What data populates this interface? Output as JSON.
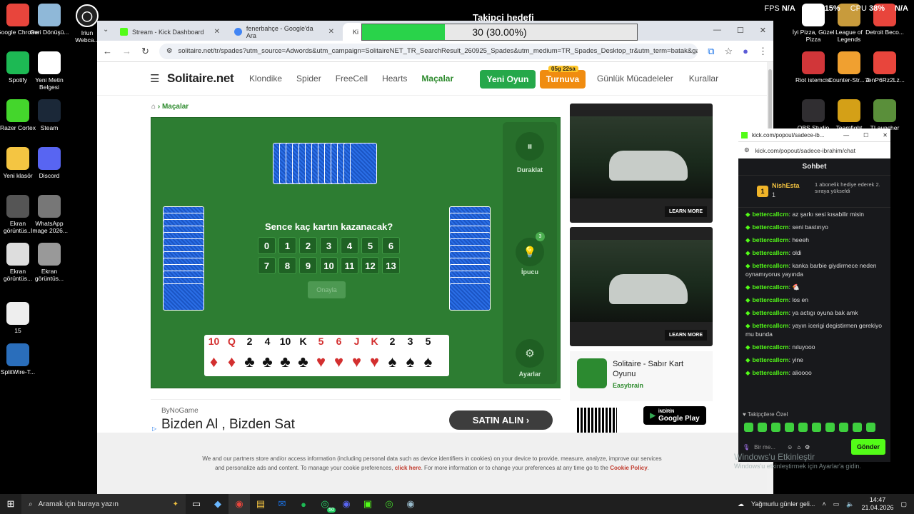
{
  "overlay": {
    "goal_title": "Takipci hedefi",
    "goal_text": "30 (30.00%)",
    "goal_progress": 0.3,
    "fps_label": "FPS",
    "fps_value": "N/A",
    "gpu_label": "GPU",
    "gpu_value": "15%",
    "cpu_label": "CPU",
    "cpu_value": "38%",
    "na_label": "N/A"
  },
  "desktop_left": [
    {
      "label": "Google Chrome",
      "icon": "chrome-icon",
      "color": "#e8453c"
    },
    {
      "label": "Geri Dönüşü...",
      "icon": "recycle-bin-icon",
      "color": "#8fb8d8"
    },
    {
      "label": "Spotify",
      "icon": "spotify-icon",
      "color": "#1db954"
    },
    {
      "label": "Yeni Metin Belgesi",
      "icon": "text-file-icon",
      "color": "#ffffff"
    },
    {
      "label": "Razer Cortex",
      "icon": "razer-icon",
      "color": "#44d62c"
    },
    {
      "label": "Steam",
      "icon": "steam-icon",
      "color": "#1b2838"
    },
    {
      "label": "Yeni klasör",
      "icon": "folder-icon",
      "color": "#f4c542"
    },
    {
      "label": "Discord",
      "icon": "discord-icon",
      "color": "#5865f2"
    },
    {
      "label": "Ekran görüntüs...",
      "icon": "image-icon",
      "color": "#555555"
    },
    {
      "label": "WhatsApp Image 2026...",
      "icon": "image-icon",
      "color": "#777777"
    },
    {
      "label": "Ekran görüntüs...",
      "icon": "image-icon",
      "color": "#dddddd"
    },
    {
      "label": "Ekran görüntüs...",
      "icon": "image-icon",
      "color": "#999999"
    },
    {
      "label": "15",
      "icon": "image-icon",
      "color": "#eeeeee"
    },
    {
      "label": "SplitWire-T...",
      "icon": "splitwire-icon",
      "color": "#2a6ebb"
    }
  ],
  "desktop_partial": {
    "label": "Iriun Webca...",
    "icon": "webcam-icon"
  },
  "desktop_right": [
    {
      "label": "İyi Pizza, Güzel Pizza",
      "icon": "file-icon",
      "color": "#ffffff"
    },
    {
      "label": "League of Legends",
      "icon": "lol-icon",
      "color": "#c89b3c"
    },
    {
      "label": "Detroit Beco...",
      "icon": "chrome-icon",
      "color": "#e8453c"
    },
    {
      "label": "Riot istemcisi",
      "icon": "riot-icon",
      "color": "#d13639"
    },
    {
      "label": "Counter-Str... 2",
      "icon": "cs2-icon",
      "color": "#f0a030"
    },
    {
      "label": "7enP6Rz2Lz...",
      "icon": "chrome-icon",
      "color": "#e8453c"
    },
    {
      "label": "OBS Studio",
      "icon": "obs-icon",
      "color": "#302e31"
    },
    {
      "label": "Teamfight",
      "icon": "tft-icon",
      "color": "#d4a017"
    },
    {
      "label": "TLauncher",
      "icon": "minecraft-icon",
      "color": "#5a8f3a"
    }
  ],
  "browser": {
    "tabs": [
      {
        "title": "Stream - Kick Dashboard",
        "fav": "#53fc18"
      },
      {
        "title": "fenerbahçe - Google'da Ara",
        "fav": "#4285f4"
      },
      {
        "title": "Ki",
        "fav": "#f0a010"
      }
    ],
    "url": "solitaire.net/tr/spades?utm_source=Adwords&utm_campaign=SolitaireNET_TR_SearchResult_260925_Spades&utm_medium=TR_Spades_Desktop_tr&utm_term=batak&gad_sou..."
  },
  "site": {
    "logo": "Solitaire.net",
    "nav": [
      "Klondike",
      "Spider",
      "FreeCell",
      "Hearts",
      "Maçalar"
    ],
    "active_nav": "Maçalar",
    "new_game": "Yeni Oyun",
    "tournament": "Turnuva",
    "tournament_badge": "05g 22sa",
    "nav_right": [
      "Günlük Mücadeleler",
      "Kurallar"
    ],
    "breadcrumb": "Maçalar"
  },
  "game": {
    "bid_question": "Sence kaç kartın kazanacak?",
    "bid_numbers": [
      "0",
      "1",
      "2",
      "3",
      "4",
      "5",
      "6",
      "7",
      "8",
      "9",
      "10",
      "11",
      "12",
      "13"
    ],
    "confirm": "Onayla",
    "pause_label": "Duraklat",
    "hint_label": "İpucu",
    "hint_count": "3",
    "settings_label": "Ayarlar",
    "hand": [
      {
        "rank": "10",
        "suit": "♦",
        "color": "#d32f2f"
      },
      {
        "rank": "Q",
        "suit": "♦",
        "color": "#d32f2f"
      },
      {
        "rank": "2",
        "suit": "♣",
        "color": "#111111"
      },
      {
        "rank": "4",
        "suit": "♣",
        "color": "#111111"
      },
      {
        "rank": "10",
        "suit": "♣",
        "color": "#111111"
      },
      {
        "rank": "K",
        "suit": "♣",
        "color": "#111111"
      },
      {
        "rank": "5",
        "suit": "♥",
        "color": "#d32f2f"
      },
      {
        "rank": "6",
        "suit": "♥",
        "color": "#d32f2f"
      },
      {
        "rank": "J",
        "suit": "♥",
        "color": "#d32f2f"
      },
      {
        "rank": "K",
        "suit": "♥",
        "color": "#d32f2f"
      },
      {
        "rank": "2",
        "suit": "♠",
        "color": "#111111"
      },
      {
        "rank": "3",
        "suit": "♠",
        "color": "#111111"
      },
      {
        "rank": "5",
        "suit": "♠",
        "color": "#111111"
      }
    ]
  },
  "ads": {
    "learn_more": "LEARN MORE",
    "app_title": "Solitaire - Sabır Kart Oyunu",
    "app_dev": "Easybrain",
    "gplay": "Google Play",
    "gplay_top": "İNDİRİN",
    "bottom_source": "ByNoGame",
    "bottom_title": "Bizden Al , Bizden Sat",
    "bottom_btn": "SATIN ALIN"
  },
  "cookie": {
    "text1": "We and our partners store and/or access information (including personal data such as device identifiers in cookies) on your device to provide, measure, analyze, improve our services and personalize ads and content. To manage your cookie preferences,",
    "link1": "click here",
    "text2": ". For more information or to change your preferences at any time go to the",
    "link2": "Cookie Policy",
    "text3": "."
  },
  "chat": {
    "window_title": "kick.com/popout/sadece-ib...",
    "url": "kick.com/popout/sadece-ibrahim/chat",
    "header": "Sohbet",
    "sub_user": "NishEsta",
    "sub_count": "1",
    "sub_text": "1 abonelik hediye ederek 2. sıraya yükseldi",
    "messages": [
      {
        "user": "bettercallcrn",
        "text": "az şarkı sesi kısabilir misin"
      },
      {
        "user": "bettercallcrn",
        "text": "seni bastırıyo"
      },
      {
        "user": "bettercallcrn",
        "text": "heeeh"
      },
      {
        "user": "bettercallcrn",
        "text": "oldi"
      },
      {
        "user": "bettercallcrn",
        "text": "kanka barbie giydirmece neden oynamıyorus yayında"
      },
      {
        "user": "bettercallcrn",
        "text": "🐔"
      },
      {
        "user": "bettercallcrn",
        "text": "los en"
      },
      {
        "user": "bettercallcrn",
        "text": "ya actıgı oyuna bak amk"
      },
      {
        "user": "bettercallcrn",
        "text": "yayın icerigi degistirmen gerekiyo mu bunda"
      },
      {
        "user": "bettercallcrn",
        "text": "nıluyooo"
      },
      {
        "user": "bettercallcrn",
        "text": "yine"
      },
      {
        "user": "bettercallcrn",
        "text": "alioooo"
      }
    ],
    "followers_only": "Takipçilere Özel",
    "input_placeholder": "Bir me...",
    "send": "Gönder"
  },
  "windows": {
    "activate1": "Windows'u Etkinleştir",
    "activate2": "Windows'u etkinleştirmek için Ayarlar'a gidin."
  },
  "taskbar": {
    "search_placeholder": "Aramak için buraya yazın",
    "weather": "Yağmurlu günler geli...",
    "time": "14:47",
    "date": "21.04.2026",
    "whatsapp_badge": "50"
  }
}
